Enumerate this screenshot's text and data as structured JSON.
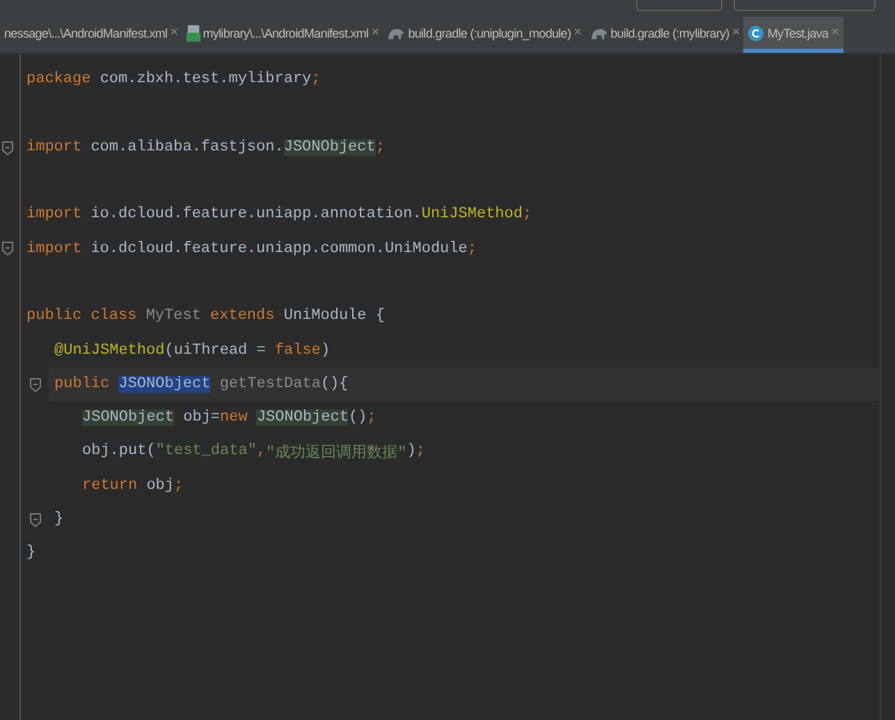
{
  "tabs": [
    {
      "label": "nessage\\...\\AndroidManifest.xml",
      "kind": "plain",
      "close": "×",
      "selected": false
    },
    {
      "label": "mylibrary\\...\\AndroidManifest.xml",
      "kind": "manifest",
      "close": "×",
      "selected": false
    },
    {
      "label": "build.gradle (:uniplugin_module)",
      "kind": "gradle",
      "close": "×",
      "selected": false
    },
    {
      "label": "build.gradle (:mylibrary)",
      "kind": "gradle",
      "close": "×",
      "selected": false
    },
    {
      "label": "MyTest.java",
      "kind": "class",
      "close": "×",
      "selected": true
    }
  ],
  "code": [
    {
      "kind": "code",
      "tokens": [
        {
          "text": "package",
          "kind": "keyword"
        },
        {
          "text": " com.zbxh.test.mylibrary",
          "kind": "plain"
        },
        {
          "text": ";",
          "kind": "keyword"
        }
      ]
    },
    {
      "kind": "blank"
    },
    {
      "kind": "code",
      "fold": true,
      "tokens": [
        {
          "text": "import",
          "kind": "keyword"
        },
        {
          "text": " com.alibaba.fastjson.",
          "kind": "plain"
        },
        {
          "text": "JSONObject",
          "kind": "plain",
          "highlighted": true
        },
        {
          "text": ";",
          "kind": "keyword"
        }
      ]
    },
    {
      "kind": "blank"
    },
    {
      "kind": "code",
      "tokens": [
        {
          "text": "import",
          "kind": "keyword"
        },
        {
          "text": " io.dcloud.feature.uniapp.annotation.",
          "kind": "plain"
        },
        {
          "text": "UniJSMethod",
          "kind": "annotation"
        },
        {
          "text": ";",
          "kind": "keyword"
        }
      ]
    },
    {
      "kind": "code",
      "fold": true,
      "tokens": [
        {
          "text": "import",
          "kind": "keyword"
        },
        {
          "text": " io.dcloud.feature.uniapp.common.UniModule",
          "kind": "plain"
        },
        {
          "text": ";",
          "kind": "keyword"
        }
      ]
    },
    {
      "kind": "blank"
    },
    {
      "kind": "code",
      "tokens": [
        {
          "text": "public class",
          "kind": "keyword"
        },
        {
          "text": " MyTest ",
          "kind": "unused"
        },
        {
          "text": "extends",
          "kind": "keyword"
        },
        {
          "text": " UniModule {",
          "kind": "plain"
        }
      ],
      "children": [
        {
          "kind": "code",
          "tokens": [
            {
              "text": "@UniJSMethod",
              "kind": "annotation"
            },
            {
              "text": "(uiThread = ",
              "kind": "plain"
            },
            {
              "text": "false",
              "kind": "keyword"
            },
            {
              "text": ")",
              "kind": "plain"
            }
          ]
        },
        {
          "kind": "code",
          "fold": true,
          "current": true,
          "tokens": [
            {
              "text": "public ",
              "kind": "keyword"
            },
            {
              "text": "JSONObject",
              "kind": "plain",
              "selected": true
            },
            {
              "text": " getTestData",
              "kind": "unused"
            },
            {
              "text": "(){",
              "kind": "plain"
            }
          ],
          "children": [
            {
              "kind": "code",
              "tokens": [
                {
                  "text": "JSONObject",
                  "kind": "plain",
                  "highlighted": true
                },
                {
                  "text": " obj=",
                  "kind": "plain"
                },
                {
                  "text": "new ",
                  "kind": "keyword"
                },
                {
                  "text": "JSONObject",
                  "kind": "plain",
                  "highlighted": true
                },
                {
                  "text": "()",
                  "kind": "plain"
                },
                {
                  "text": ";",
                  "kind": "keyword"
                }
              ]
            },
            {
              "kind": "code",
              "tokens": [
                {
                  "text": "obj.put(",
                  "kind": "plain"
                },
                {
                  "text": "\"test_data\"",
                  "kind": "string"
                },
                {
                  "text": ",",
                  "kind": "keyword"
                },
                {
                  "text": "\"成功返回调用数据\"",
                  "kind": "string"
                },
                {
                  "text": ")",
                  "kind": "plain"
                },
                {
                  "text": ";",
                  "kind": "keyword"
                }
              ]
            },
            {
              "kind": "code",
              "tokens": [
                {
                  "text": "return",
                  "kind": "keyword"
                },
                {
                  "text": " obj",
                  "kind": "plain"
                },
                {
                  "text": ";",
                  "kind": "keyword"
                }
              ]
            }
          ]
        },
        {
          "kind": "code",
          "fold": true,
          "tokens": [
            {
              "text": "}",
              "kind": "plain"
            }
          ]
        }
      ]
    },
    {
      "kind": "code",
      "tokens": [
        {
          "text": "}",
          "kind": "plain"
        }
      ]
    }
  ]
}
